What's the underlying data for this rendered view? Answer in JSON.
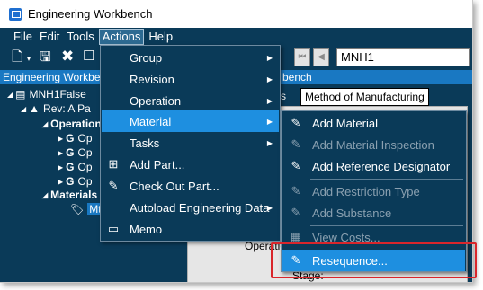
{
  "window": {
    "title": "Engineering Workbench"
  },
  "menubar": {
    "items": [
      {
        "label": "File"
      },
      {
        "label": "Edit"
      },
      {
        "label": "Tools"
      },
      {
        "label": "Actions"
      },
      {
        "label": "Help"
      }
    ]
  },
  "toolbar": {
    "record_value": "MNH1"
  },
  "strip": {
    "left_text": "Engineering Workbench",
    "right_text": "bench"
  },
  "tree": {
    "root": "MNH1False",
    "revision": "Rev: A Pa",
    "operations": "Operation",
    "op_items": [
      "Op",
      "Op",
      "Op",
      "Op"
    ],
    "materials": "Materials",
    "material_item": "Mt"
  },
  "tabs": {
    "partial": "s",
    "active": "Method of Manufacturing"
  },
  "panel": {
    "operation_label": "Operatio",
    "stage_label": "Stage:"
  },
  "actions_menu": {
    "items": [
      {
        "label": "Group",
        "submenu": true
      },
      {
        "label": "Revision",
        "submenu": true
      },
      {
        "label": "Operation",
        "submenu": true
      },
      {
        "label": "Material",
        "submenu": true,
        "highlighted": true
      },
      {
        "label": "Tasks",
        "submenu": true
      },
      {
        "label": "Add Part...",
        "icon": "add-part-icon"
      },
      {
        "label": "Check Out Part...",
        "icon": "check-out-icon"
      },
      {
        "label": "Autoload Engineering Data",
        "submenu": true
      },
      {
        "label": "Memo",
        "icon": "memo-icon"
      }
    ]
  },
  "material_menu": {
    "items": [
      {
        "label": "Add Material",
        "enabled": true
      },
      {
        "label": "Add Material Inspection",
        "enabled": false
      },
      {
        "label": "Add Reference Designator",
        "enabled": true
      },
      {
        "label": "Add Restriction Type",
        "enabled": false
      },
      {
        "label": "Add Substance",
        "enabled": false
      },
      {
        "label": "View Costs...",
        "enabled": false
      },
      {
        "label": "Resequence...",
        "enabled": true,
        "highlighted": true
      }
    ]
  },
  "colors": {
    "app_background": "#0a3a58",
    "menu_highlight": "#1e8fe0",
    "callout_border": "#d9262b",
    "strip": "#1978c2"
  }
}
